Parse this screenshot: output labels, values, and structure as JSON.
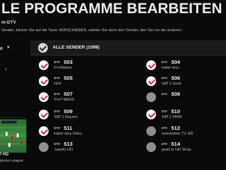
{
  "header": {
    "title": "LE PROGRAMME BEARBEITEN",
    "subtitle": "m-DTV",
    "instruction": "Sender, klicken Sie auf die Taste VERSCHIEBEN, wählen Sie dann den Sender, den Sie vor die anderen :"
  },
  "left": {
    "filter_label": "e",
    "filter_arrow": "▼",
    "back_arrow": "‹",
    "preview_caption_1": "f HD",
    "preview_caption_2": "pions League"
  },
  "all_channels": {
    "label": "ALLE SENDER (1099)",
    "checked": true
  },
  "channel_tag": "DTV",
  "channels_left": [
    {
      "num": "503",
      "name": "ProSieben",
      "checked": true
    },
    {
      "num": "505",
      "name": "N24",
      "checked": true
    },
    {
      "num": "507",
      "name": "Pro7 MAXX",
      "checked": true
    },
    {
      "num": "509",
      "name": "SAT.1 Bayern",
      "checked": true
    },
    {
      "num": "511",
      "name": "kabel eins Doku",
      "checked": true
    },
    {
      "num": "513",
      "name": "Juwelo HD",
      "checked": false
    }
  ],
  "channels_right": [
    {
      "num": "504",
      "name": "kabel eins",
      "checked": true
    },
    {
      "num": "506",
      "name": "SAT.1 Gold",
      "checked": true
    },
    {
      "num": "508",
      "name": "",
      "checked": false
    },
    {
      "num": "510",
      "name": "SAT.1 NRW",
      "checked": true
    },
    {
      "num": "512",
      "name": "sonnenklar TV HD",
      "checked": false
    },
    {
      "num": "514",
      "name": "pearl.tv HD Shop",
      "checked": false
    }
  ],
  "colors": {
    "accent": "#d0224a",
    "background": "#0a0a0a"
  }
}
